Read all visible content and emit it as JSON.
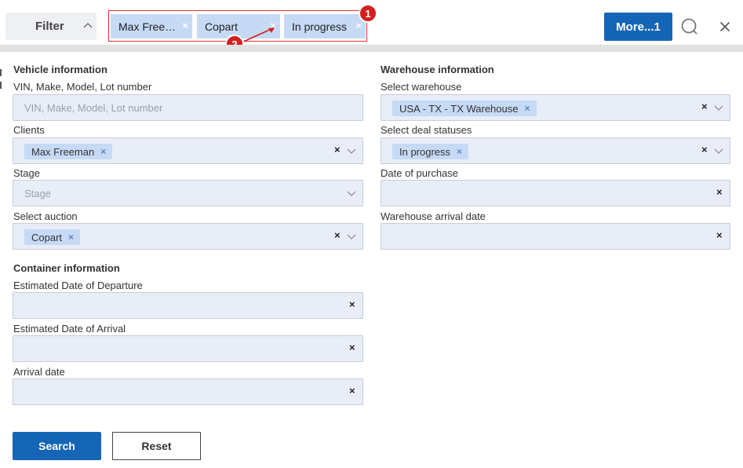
{
  "header": {
    "filter_label": "Filter",
    "chips": [
      {
        "label": "Max Free…"
      },
      {
        "label": "Copart"
      },
      {
        "label": "In progress"
      }
    ],
    "chip_remove_symbol": "×",
    "more_label": "More...1",
    "annotations": [
      "1",
      "2"
    ]
  },
  "vehicle": {
    "title": "Vehicle information",
    "vin_label": "VIN, Make, Model, Lot number",
    "vin_placeholder": "VIN, Make, Model, Lot number",
    "clients_label": "Clients",
    "clients_chip": "Max Freeman",
    "stage_label": "Stage",
    "stage_placeholder": "Stage",
    "auction_label": "Select auction",
    "auction_chip": "Copart"
  },
  "container": {
    "title": "Container information",
    "departure_label": "Estimated Date of Departure",
    "arrival_est_label": "Estimated Date of Arrival",
    "arrival_label": "Arrival date"
  },
  "warehouse": {
    "title": "Warehouse information",
    "warehouse_label": "Select warehouse",
    "warehouse_chip": "USA - TX - TX Warehouse",
    "status_label": "Select deal statuses",
    "status_chip": "In progress",
    "purchase_label": "Date of purchase",
    "arrival_label": "Warehouse arrival date"
  },
  "actions": {
    "search_label": "Search",
    "reset_label": "Reset"
  },
  "colors": {
    "primary": "#1565b7",
    "chip": "#c6daf5",
    "field_bg": "#e8edf8",
    "annotation": "#d42020"
  }
}
